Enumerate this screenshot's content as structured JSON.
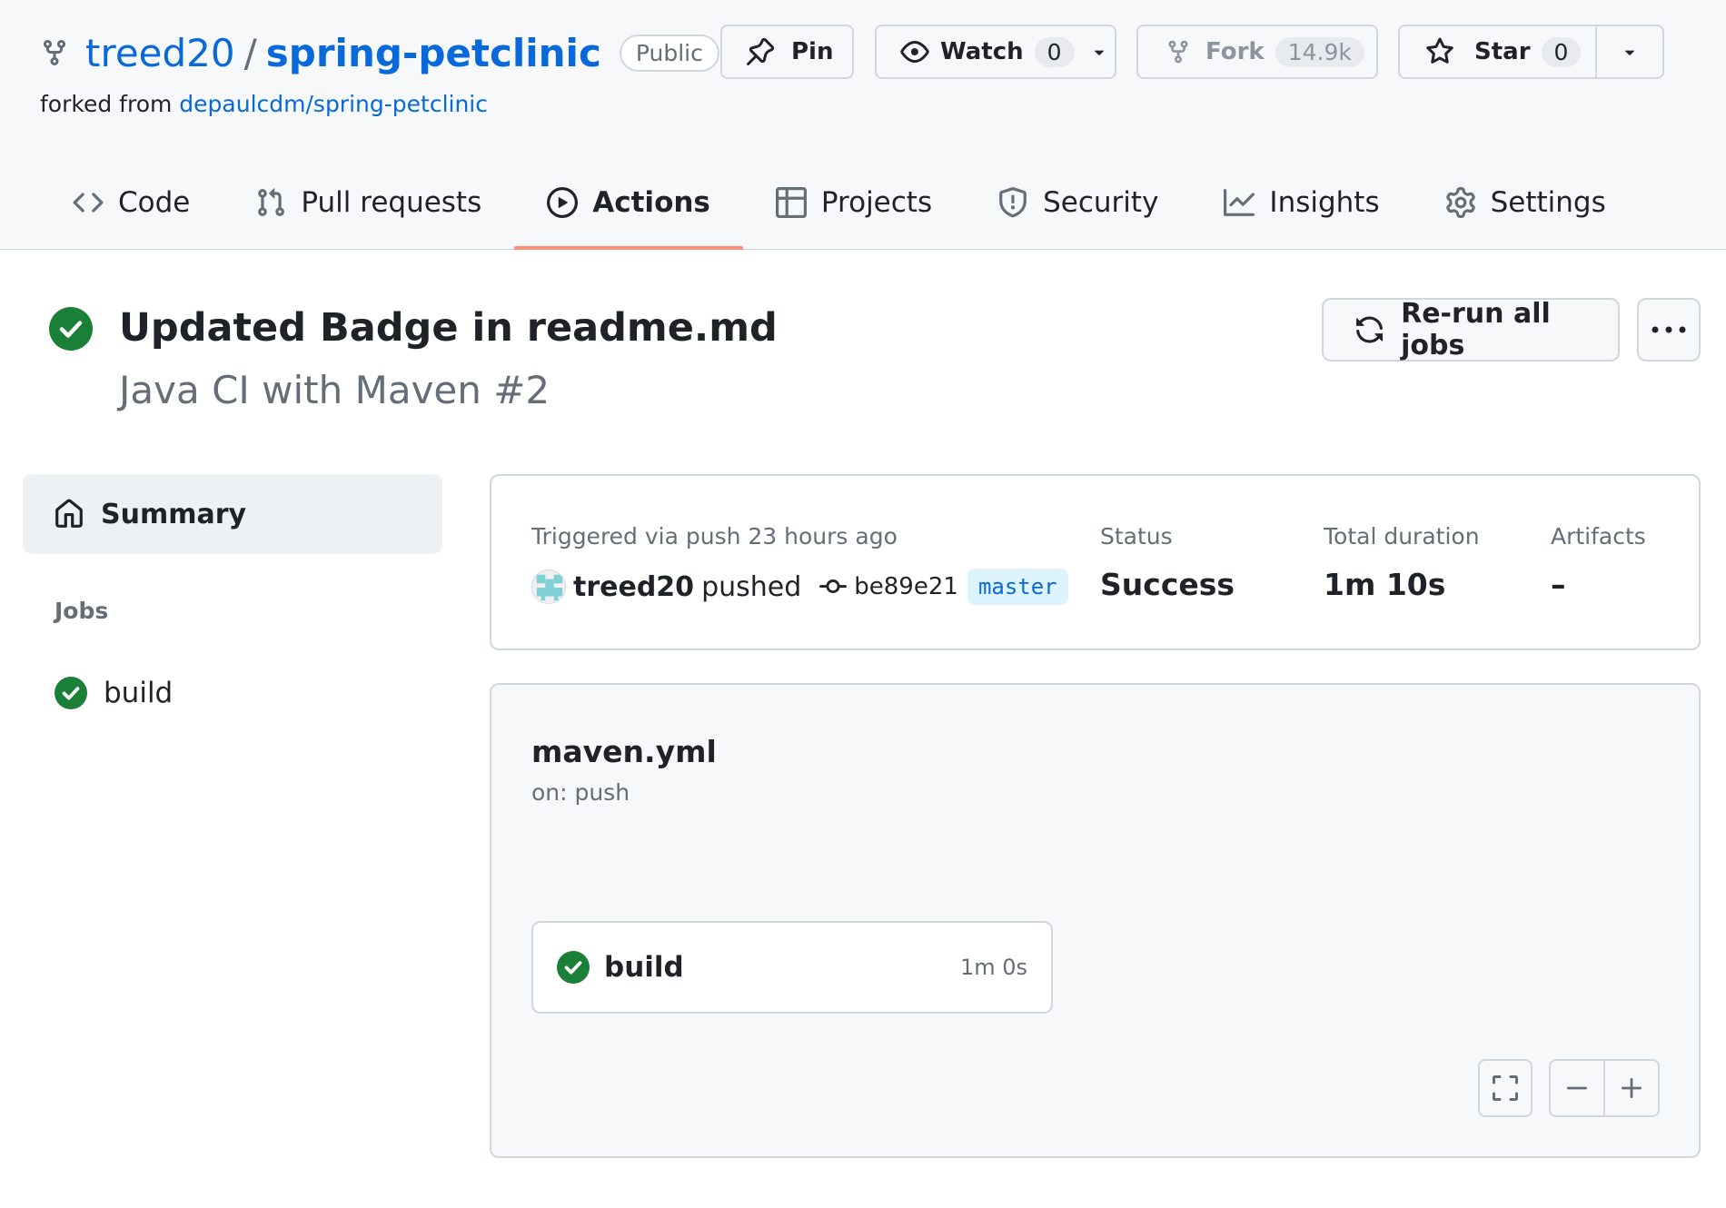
{
  "repo": {
    "owner": "treed20",
    "separator": "/",
    "name": "spring-petclinic",
    "visibility": "Public",
    "forked_from_prefix": "forked from",
    "forked_from_link": "depaulcdm/spring-petclinic"
  },
  "header_actions": {
    "pin_label": "Pin",
    "watch_label": "Watch",
    "watch_count": "0",
    "fork_label": "Fork",
    "fork_count": "14.9k",
    "star_label": "Star",
    "star_count": "0"
  },
  "tabs": [
    {
      "label": "Code",
      "icon": "code-icon",
      "active": false
    },
    {
      "label": "Pull requests",
      "icon": "pull-request-icon",
      "active": false
    },
    {
      "label": "Actions",
      "icon": "play-icon",
      "active": true
    },
    {
      "label": "Projects",
      "icon": "table-icon",
      "active": false
    },
    {
      "label": "Security",
      "icon": "shield-icon",
      "active": false
    },
    {
      "label": "Insights",
      "icon": "graph-icon",
      "active": false
    },
    {
      "label": "Settings",
      "icon": "gear-icon",
      "active": false
    }
  ],
  "run": {
    "title": "Updated Badge in readme.md",
    "subtitle": "Java CI with Maven #2",
    "status_icon": "check-circle-icon",
    "rerun_label": "Re-run all jobs"
  },
  "sidebar": {
    "summary_label": "Summary",
    "jobs_heading": "Jobs",
    "jobs": [
      {
        "label": "build",
        "status": "success"
      }
    ]
  },
  "summary": {
    "triggered_text": "Triggered via push 23 hours ago",
    "actor": "treed20",
    "action": "pushed",
    "commit_sha": "be89e21",
    "branch": "master",
    "status_label": "Status",
    "status_value": "Success",
    "duration_label": "Total duration",
    "duration_value": "1m 10s",
    "artifacts_label": "Artifacts",
    "artifacts_value": "–"
  },
  "workflow": {
    "file": "maven.yml",
    "trigger": "on: push",
    "jobs": [
      {
        "name": "build",
        "duration": "1m 0s",
        "status": "success"
      }
    ]
  },
  "colors": {
    "accent_blue": "#0969da",
    "success_green": "#1a7f37",
    "active_tab_underline": "#fd8c73",
    "muted_text": "#656d76"
  }
}
